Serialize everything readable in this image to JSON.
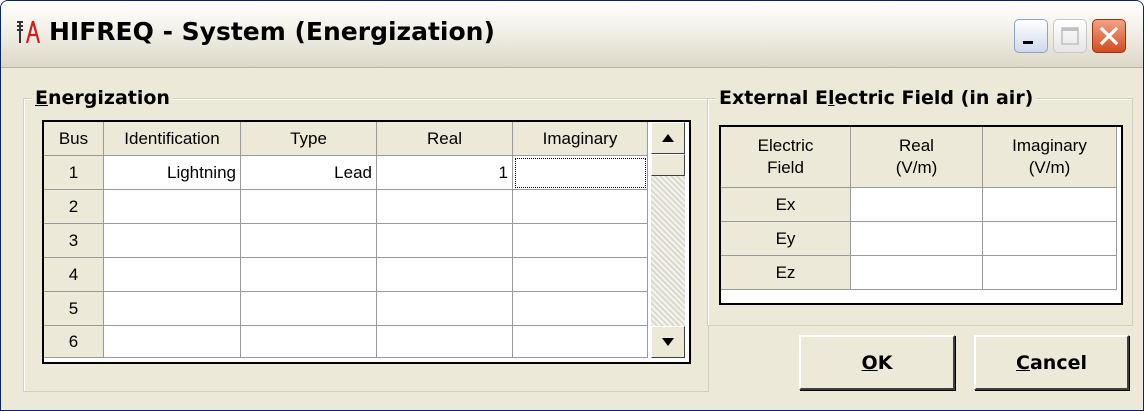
{
  "window": {
    "title": "HIFREQ - System (Energization)"
  },
  "energization": {
    "group_label_pre": "",
    "group_label_key": "E",
    "group_label_post": "nergization",
    "columns": [
      "Bus",
      "Identification",
      "Type",
      "Real",
      "Imaginary"
    ],
    "rows": [
      {
        "bus": "1",
        "identification": "Lightning",
        "type": "Lead",
        "real": "1",
        "imaginary": ""
      },
      {
        "bus": "2",
        "identification": "",
        "type": "",
        "real": "",
        "imaginary": ""
      },
      {
        "bus": "3",
        "identification": "",
        "type": "",
        "real": "",
        "imaginary": ""
      },
      {
        "bus": "4",
        "identification": "",
        "type": "",
        "real": "",
        "imaginary": ""
      },
      {
        "bus": "5",
        "identification": "",
        "type": "",
        "real": "",
        "imaginary": ""
      },
      {
        "bus": "6",
        "identification": "",
        "type": "",
        "real": "",
        "imaginary": ""
      }
    ]
  },
  "external_field": {
    "group_label_pre": "External E",
    "group_label_key": "l",
    "group_label_post": "ectric Field (in air)",
    "columns": [
      "Electric\nField",
      "Real\n(V/m)",
      "Imaginary\n(V/m)"
    ],
    "rows": [
      {
        "field": "Ex",
        "real": "",
        "imaginary": ""
      },
      {
        "field": "Ey",
        "real": "",
        "imaginary": ""
      },
      {
        "field": "Ez",
        "real": "",
        "imaginary": ""
      }
    ]
  },
  "buttons": {
    "ok_key": "O",
    "ok_rest": "K",
    "cancel_key": "C",
    "cancel_rest": "ancel"
  },
  "colors": {
    "titlebar_text": "#000000",
    "close_button": "#d04c1f",
    "dialog_face": "#ece9d8",
    "app_icon_red": "#d81a1a",
    "app_icon_dark": "#333333"
  },
  "icons": {
    "app": "hifreq-tower-icon",
    "minimize": "minimize-icon",
    "maximize": "maximize-icon",
    "close": "close-icon"
  }
}
